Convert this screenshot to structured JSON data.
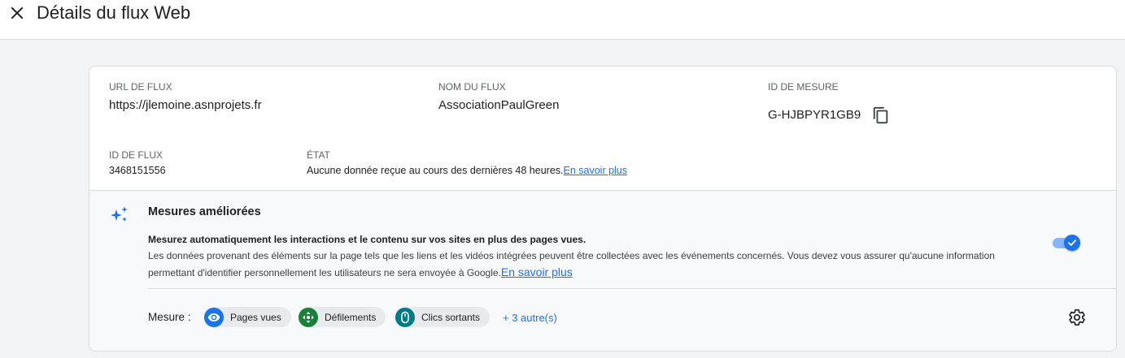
{
  "header": {
    "title": "Détails du flux Web"
  },
  "stream": {
    "url_label": "URL DE FLUX",
    "url_value": "https://jlemoine.asnprojets.fr",
    "name_label": "NOM DU FLUX",
    "name_value": "AssociationPaulGreen",
    "measure_id_label": "ID DE MESURE",
    "measure_id_value": "G-HJBPYR1GB9",
    "stream_id_label": "ID DE FLUX",
    "stream_id_value": "3468151556",
    "state_label": "ÉTAT",
    "state_value": "Aucune donnée reçue au cours des dernières 48 heures.",
    "state_link": "En savoir plus"
  },
  "enhanced": {
    "title": "Mesures améliorées",
    "bold_text": "Mesurez automatiquement les interactions et le contenu sur vos sites en plus des pages vues.",
    "description": "Les données provenant des éléments sur la page tels que les liens et les vidéos intégrées peuvent être collectées avec les événements concernés. Vous devez vous assurer qu'aucune information permettant d'identifier personnellement les utilisateurs ne sera envoyée à Google.",
    "link": "En savoir plus",
    "toggle_on": true,
    "measure_label": "Mesure :",
    "chips": [
      {
        "label": "Pages vues",
        "icon": "eye-icon",
        "color": "#1a73e8"
      },
      {
        "label": "Défilements",
        "icon": "arrows-move-icon",
        "color": "#188038"
      },
      {
        "label": "Clics sortants",
        "icon": "mouse-icon",
        "color": "#007b83"
      }
    ],
    "more_link": "+ 3 autre(s)"
  },
  "colors": {
    "accent": "#1a73e8",
    "green": "#188038",
    "teal": "#007b83"
  }
}
